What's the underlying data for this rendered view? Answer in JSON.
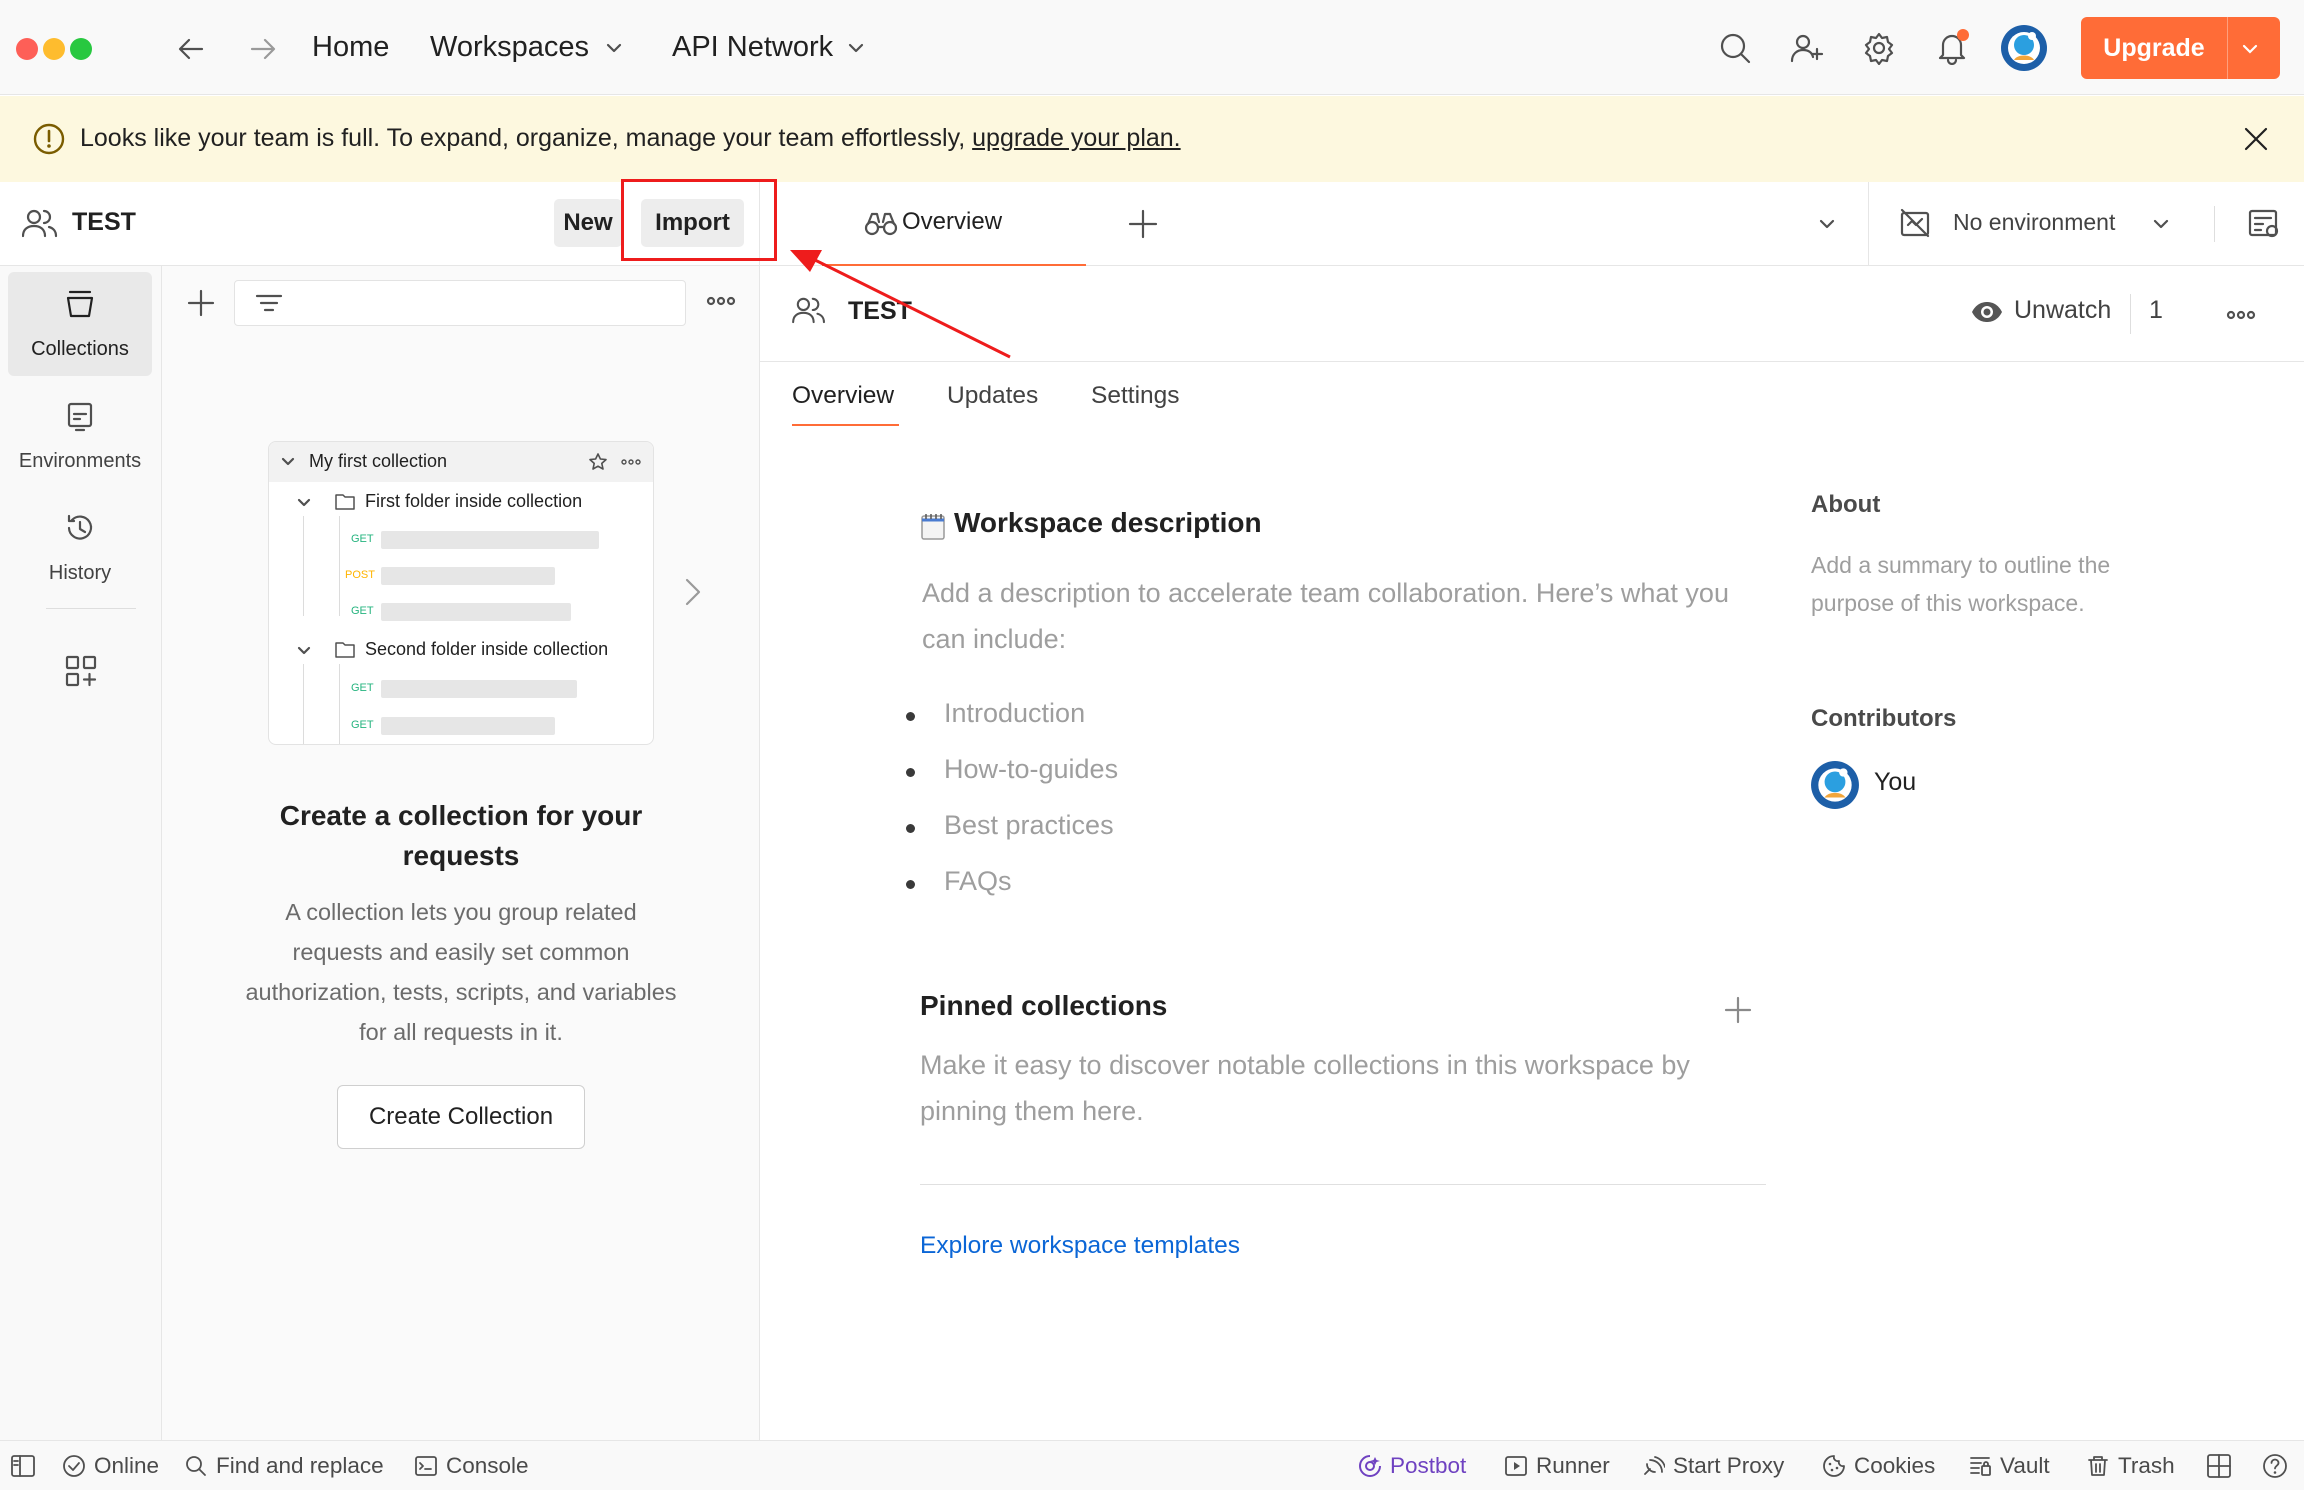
{
  "titlebar": {
    "nav": {
      "home": "Home",
      "workspaces": "Workspaces",
      "api_network": "API Network"
    },
    "upgrade_label": "Upgrade"
  },
  "banner": {
    "message": "Looks like your team is full. To expand, organize, manage your team effortlessly, ",
    "link": "upgrade your plan."
  },
  "workspace": {
    "name": "TEST",
    "new_label": "New",
    "import_label": "Import"
  },
  "tabs": {
    "overview_label": "Overview",
    "environment": "No environment"
  },
  "leftnav": [
    {
      "label": "Collections",
      "icon": "collections-icon"
    },
    {
      "label": "Environments",
      "icon": "environments-icon"
    },
    {
      "label": "History",
      "icon": "history-icon"
    }
  ],
  "sidebar": {
    "preview": {
      "collection": "My first collection",
      "folder1": "First folder inside collection",
      "folder2": "Second folder inside collection",
      "methods": [
        "GET",
        "POST",
        "GET",
        "GET",
        "GET"
      ]
    },
    "title": "Create a collection for your requests",
    "description": "A collection lets you group related requests and easily set common authorization, tests, scripts, and variables for all requests in it.",
    "create_label": "Create Collection"
  },
  "main": {
    "workspace_name": "TEST",
    "unwatch_label": "Unwatch",
    "watch_count": "1",
    "subtabs": [
      "Overview",
      "Updates",
      "Settings"
    ],
    "description": {
      "heading": "Workspace description",
      "text": "Add a description to accelerate team collaboration. Here’s what you can include:",
      "bullets": [
        "Introduction",
        "How-to-guides",
        "Best practices",
        "FAQs"
      ]
    },
    "pinned": {
      "heading": "Pinned collections",
      "text": "Make it easy to discover notable collections in this workspace by pinning them here."
    },
    "explore_link": "Explore workspace templates",
    "about": {
      "heading": "About",
      "text": "Add a summary to outline the purpose of this workspace."
    },
    "contributors": {
      "heading": "Contributors",
      "you": "You"
    }
  },
  "statusbar": {
    "online": "Online",
    "find_replace": "Find and replace",
    "console": "Console",
    "postbot": "Postbot",
    "runner": "Runner",
    "start_proxy": "Start Proxy",
    "cookies": "Cookies",
    "vault": "Vault",
    "trash": "Trash"
  },
  "colors": {
    "accent": "#ff6c37",
    "banner_bg": "#fdf8df",
    "link": "#0b66d6",
    "highlight": "#ee1c1c",
    "postbot": "#6f42c1"
  }
}
